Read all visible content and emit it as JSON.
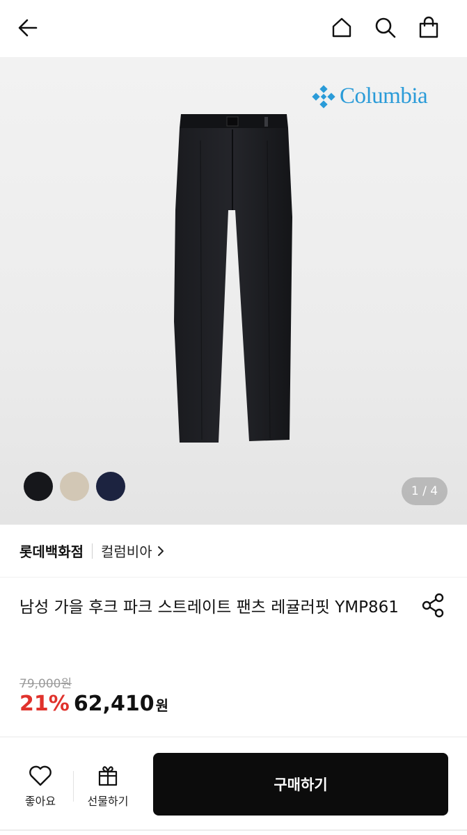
{
  "header": {
    "back_icon": "arrow-left-icon",
    "home_icon": "home-icon",
    "search_icon": "search-icon",
    "cart_icon": "shopping-bag-icon"
  },
  "hero": {
    "brand_logo_text": "Columbia",
    "counter": "1 / 4",
    "swatches": [
      {
        "color": "#16171b"
      },
      {
        "color": "#d2c7b5"
      },
      {
        "color": "#1c2340"
      }
    ]
  },
  "store": {
    "name": "롯데백화점",
    "brand": "컬럼비아"
  },
  "product": {
    "title": "남성 가을 후크 파크 스트레이트 팬츠 레귤러핏 YMP861",
    "original_price": "79,000원",
    "discount": "21%",
    "price": "62,410",
    "currency": "원"
  },
  "bottom_bar": {
    "like_label": "좋아요",
    "gift_label": "선물하기",
    "buy_label": "구매하기"
  },
  "colors": {
    "accent_red": "#e0322c",
    "brand_blue": "#2a9bd8",
    "buy_button": "#0c0c0c"
  }
}
